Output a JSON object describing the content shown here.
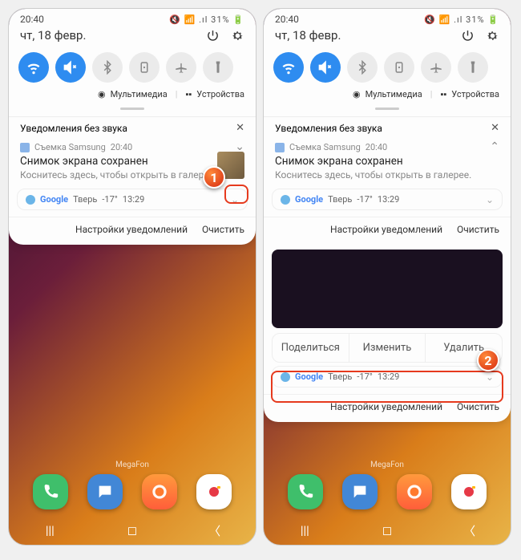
{
  "status": {
    "time": "20:40",
    "battery": "31%"
  },
  "date": "чт, 18 февр.",
  "sub": {
    "media": "Мультимедиа",
    "devices": "Устройства"
  },
  "silent_header": "Уведомления без звука",
  "screenshot": {
    "app": "Съемка Samsung",
    "time": "20:40",
    "title": "Снимок экрана сохранен",
    "body": "Коснитесь здесь, чтобы открыть в галерее."
  },
  "google": {
    "app": "Google",
    "city": "Тверь",
    "temp": "-17°",
    "time": "13:29"
  },
  "footer": {
    "settings": "Настройки уведомлений",
    "clear": "Очистить"
  },
  "actions": {
    "share": "Поделиться",
    "edit": "Изменить",
    "delete": "Удалить"
  },
  "carrier": "MegaFon",
  "callouts": {
    "one": "1",
    "two": "2"
  }
}
